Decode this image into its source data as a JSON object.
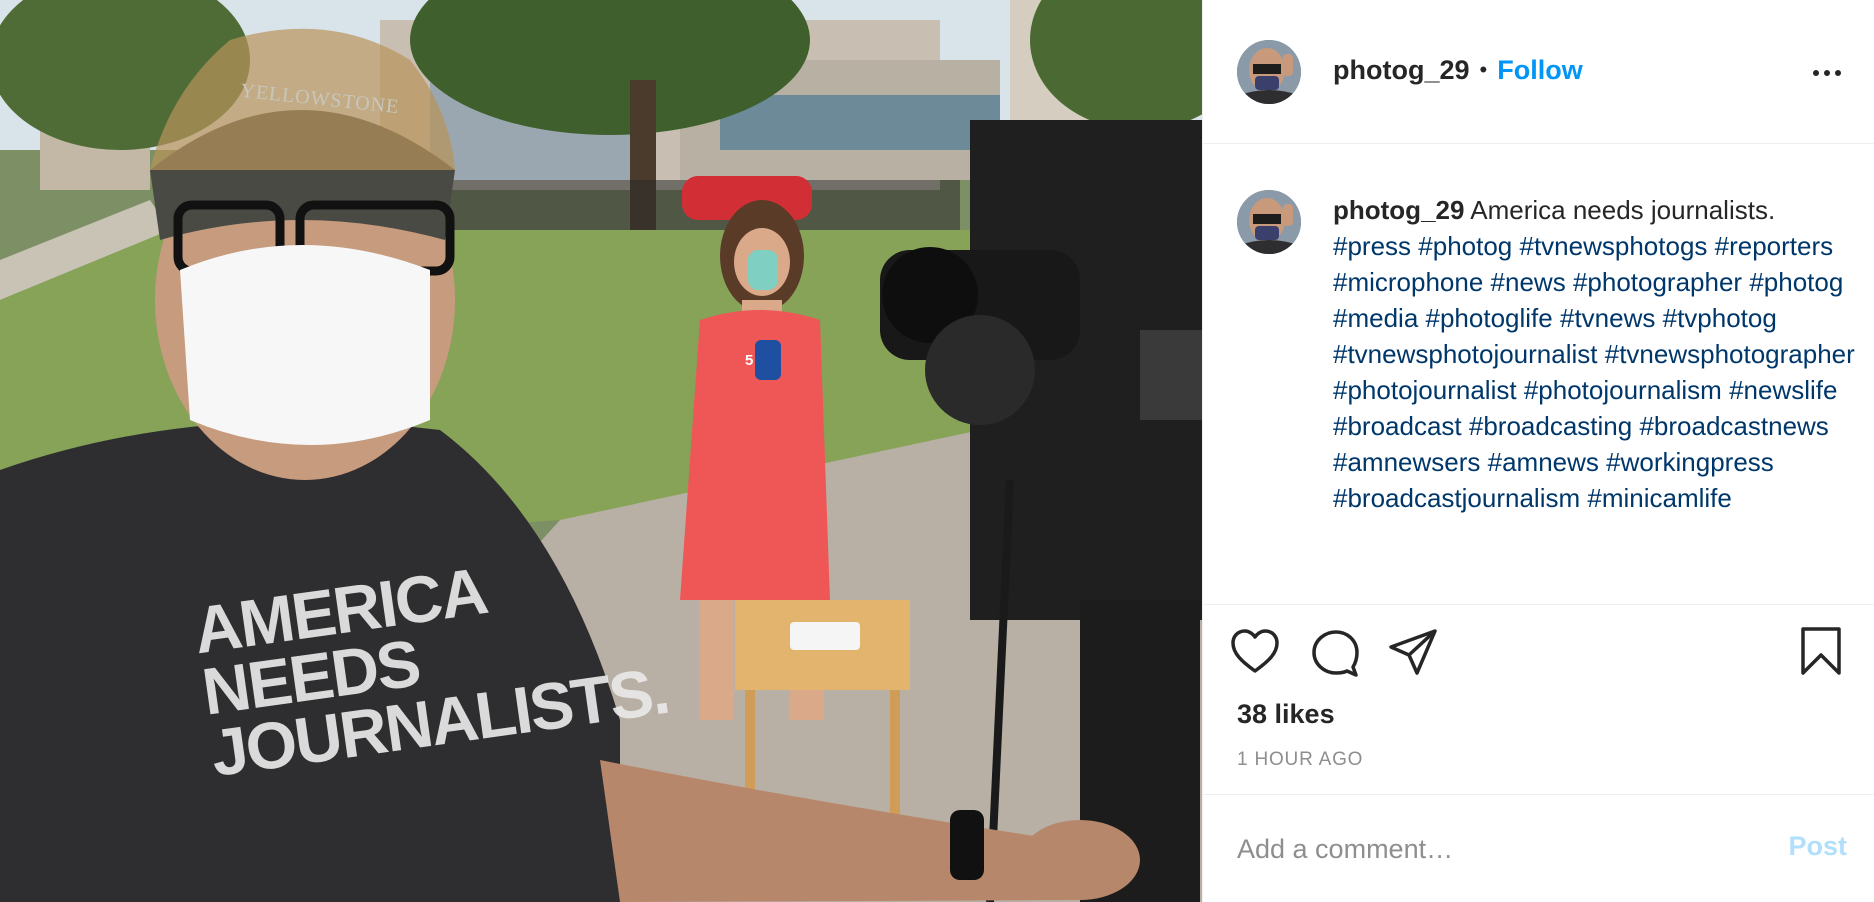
{
  "photo": {
    "shirt_text": "AMERICA\nNEEDS\nJOURNALISTS.",
    "visor_text": "YELLOWSTONE",
    "mic_logo": "5"
  },
  "header": {
    "username": "photog_29",
    "separator": "•",
    "follow_label": "Follow",
    "more_icon": "more-horizontal-icon"
  },
  "caption": {
    "username": "photog_29",
    "text": "America needs journalists.",
    "hashtags": [
      "#press",
      "#photog",
      "#tvnewsphotogs",
      "#reporters",
      "#microphone",
      "#news",
      "#photographer",
      "#photog",
      "#media",
      "#photoglife",
      "#tvnews",
      "#tvphotog",
      "#tvnewsphotojournalist",
      "#tvnewsphotographer",
      "#photojournalist",
      "#photojournalism",
      "#newslife",
      "#broadcast",
      "#broadcasting",
      "#broadcastnews",
      "#amnewsers",
      "#amnews",
      "#workingpress",
      "#broadcastjournalism",
      "#minicamlife"
    ]
  },
  "actions": {
    "like_icon": "heart-icon",
    "comment_icon": "comment-bubble-icon",
    "share_icon": "paper-plane-icon",
    "save_icon": "bookmark-icon"
  },
  "likes": "38 likes",
  "timestamp": "1 HOUR AGO",
  "comment_box": {
    "placeholder": "Add a comment…",
    "post_label": "Post"
  },
  "colors": {
    "link_blue": "#0095f6",
    "hashtag_blue": "#00376b",
    "post_disabled": "#b2dffc",
    "text": "#262626",
    "muted": "#8e8e8e",
    "border": "#efefef"
  }
}
